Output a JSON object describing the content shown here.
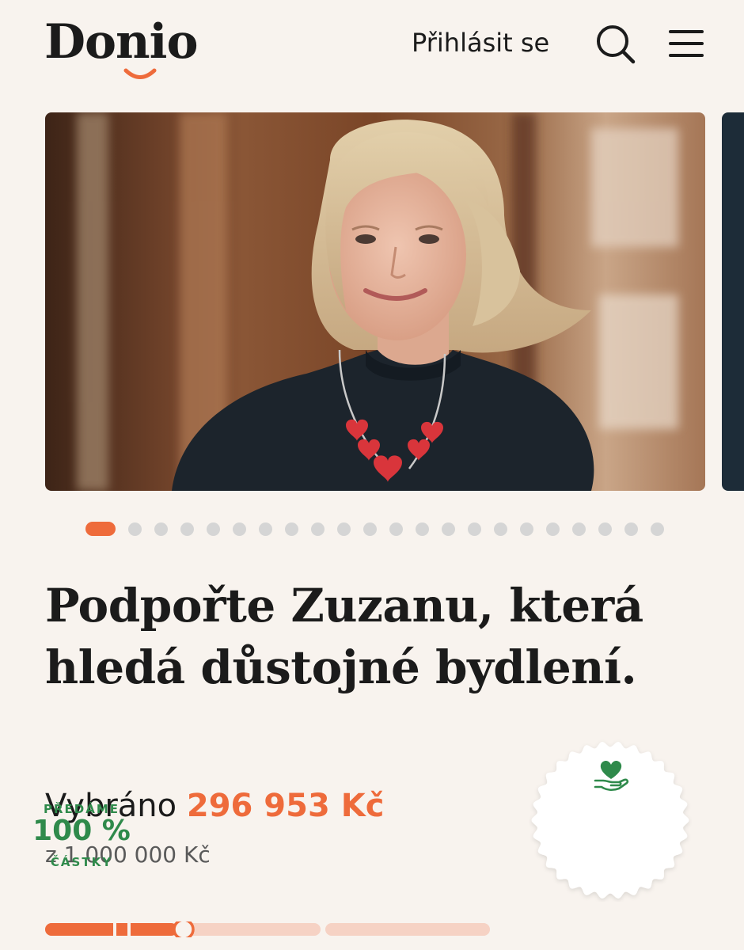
{
  "header": {
    "logo": "Donio",
    "login_label": "Přihlásit se",
    "search_icon": "search-icon",
    "menu_icon": "hamburger-menu-icon"
  },
  "hero": {
    "slide_count": 22,
    "active_slide": 1,
    "image": "photo of a smiling woman with blonde hair wearing a black top and a red heart necklace"
  },
  "campaign": {
    "title_line1": "Podpořte Zuzanu, která",
    "title_line2": "hledá důstojné bydlení.",
    "raised_label": "Vybráno",
    "raised_amount": "296 953 Kč",
    "goal_text": "z 1 000 000 Kč",
    "progress_fraction": 0.297
  },
  "badge": {
    "icon": "heart-hand-icon",
    "line1": "PŘEDÁME",
    "line2": "100 %",
    "line3": "ČÁSTKY"
  },
  "colors": {
    "background": "#f8f3ee",
    "accent": "#ee6b3b",
    "badge_green": "#2f8a4b",
    "text": "#1b1b1b"
  }
}
